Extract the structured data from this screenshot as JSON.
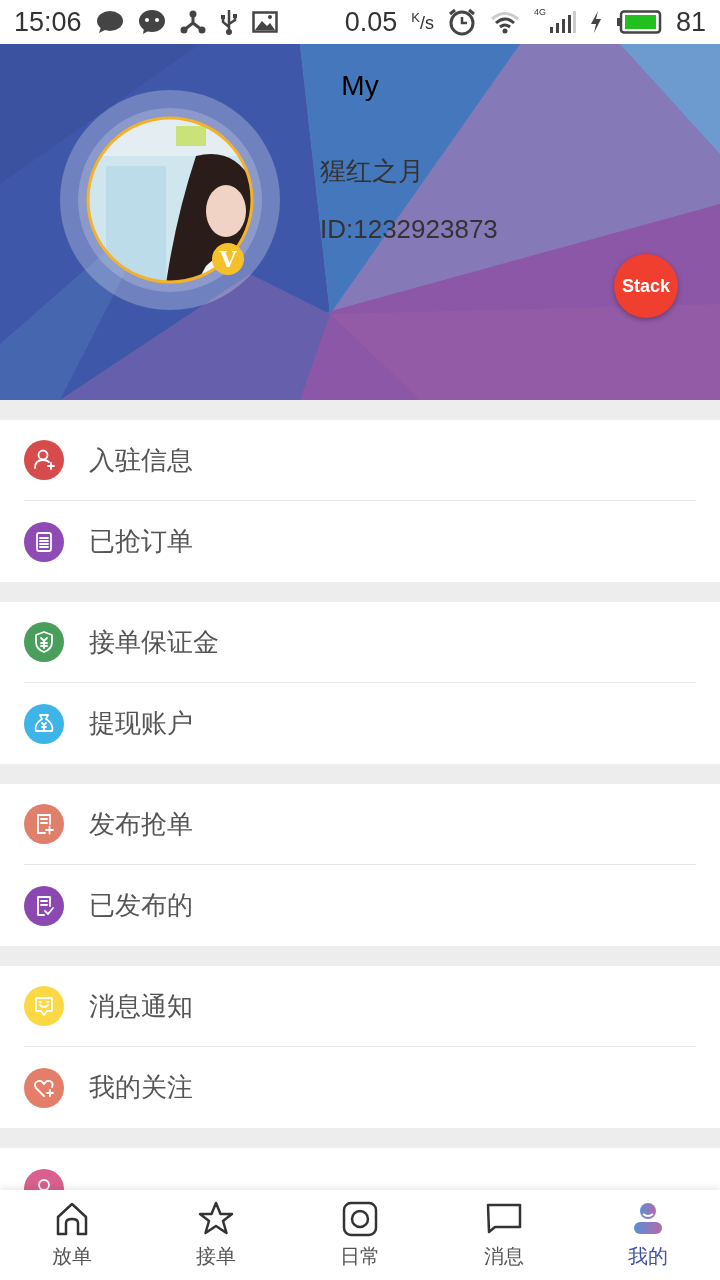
{
  "status_bar": {
    "time": "15:06",
    "speed": "0.05",
    "speed_unit": "$^{K}$/s",
    "network": "4G",
    "battery": "81"
  },
  "header": {
    "title": "My",
    "name": "猩红之月",
    "id": "ID:1232923873",
    "badge": "V",
    "action": "Stack"
  },
  "menu_groups": [
    {
      "items": [
        {
          "label": "入驻信息",
          "color": "#d64c4c"
        },
        {
          "label": "已抢订单",
          "color": "#8e4bb5"
        }
      ]
    },
    {
      "items": [
        {
          "label": "接单保证金",
          "color": "#4a9e5c"
        },
        {
          "label": "提现账户",
          "color": "#3fb4e8"
        }
      ]
    },
    {
      "items": [
        {
          "label": "发布抢单",
          "color": "#e07f6b"
        },
        {
          "label": "已发布的",
          "color": "#8a48b0"
        }
      ]
    },
    {
      "items": [
        {
          "label": "消息通知",
          "color": "#fcd844"
        },
        {
          "label": "我的关注",
          "color": "#e37e6b"
        }
      ]
    },
    {
      "items": [
        {
          "color": "#d9608e"
        }
      ]
    }
  ],
  "tabs": [
    {
      "label": "放单",
      "selected": false
    },
    {
      "label": "接单",
      "selected": false
    },
    {
      "label": "日常",
      "selected": false
    },
    {
      "label": "消息",
      "selected": false
    },
    {
      "label": "我的",
      "selected": true
    }
  ]
}
